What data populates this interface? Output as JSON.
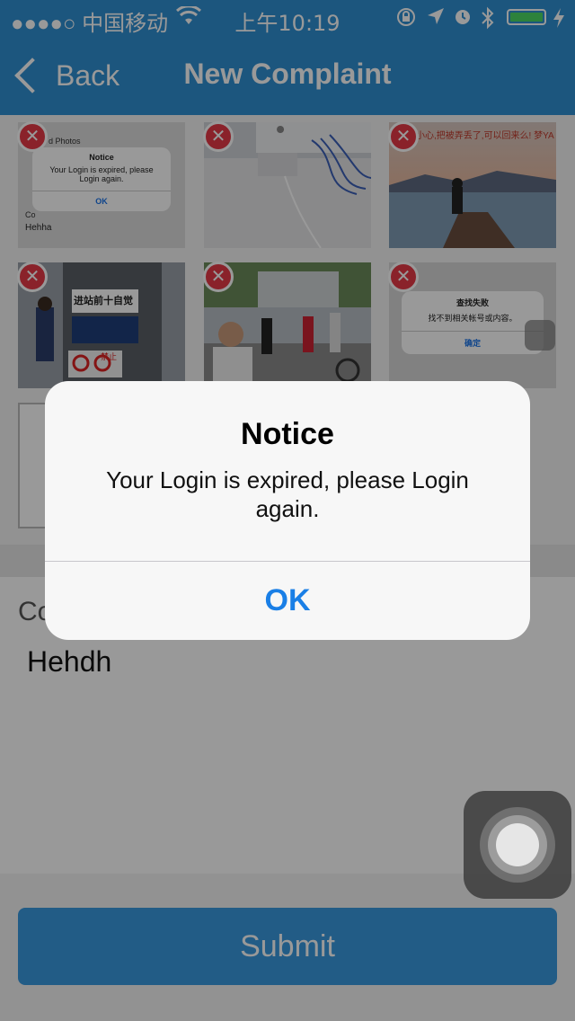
{
  "status_bar": {
    "carrier": "●●●●○ 中国移动",
    "time": "上午10:19",
    "icons": [
      "wifi-icon",
      "orientation-lock-icon",
      "location-icon",
      "alarm-icon",
      "bluetooth-icon",
      "battery-icon",
      "charging-icon"
    ]
  },
  "nav": {
    "back_label": "Back",
    "title": "New Complaint"
  },
  "photos": {
    "thumb1": {
      "title": "Notice",
      "message": "Your Login is expired, please Login again.",
      "ok": "OK",
      "text1": "d Photos",
      "text2": "Co",
      "text3": "Hehha"
    },
    "thumb3": {
      "caption": "小心,把被弄丢了,可以回来么! 梦YA"
    },
    "thumb4": {
      "sign1": "进站前十自觉",
      "sign2": "禁止"
    },
    "thumb6": {
      "title": "查找失败",
      "message": "找不到相关帐号或内容。",
      "ok": "确定"
    }
  },
  "form": {
    "content_label": "Co",
    "content_value": "Hehdh",
    "submit_label": "Submit"
  },
  "alert": {
    "title": "Notice",
    "message": "Your Login is expired, please Login again.",
    "ok_label": "OK"
  },
  "colors": {
    "nav_bar": "#2f8fd2",
    "alert_button": "#1a7fe6",
    "delete_badge": "#e63946",
    "submit_button": "#3a9ae0"
  }
}
